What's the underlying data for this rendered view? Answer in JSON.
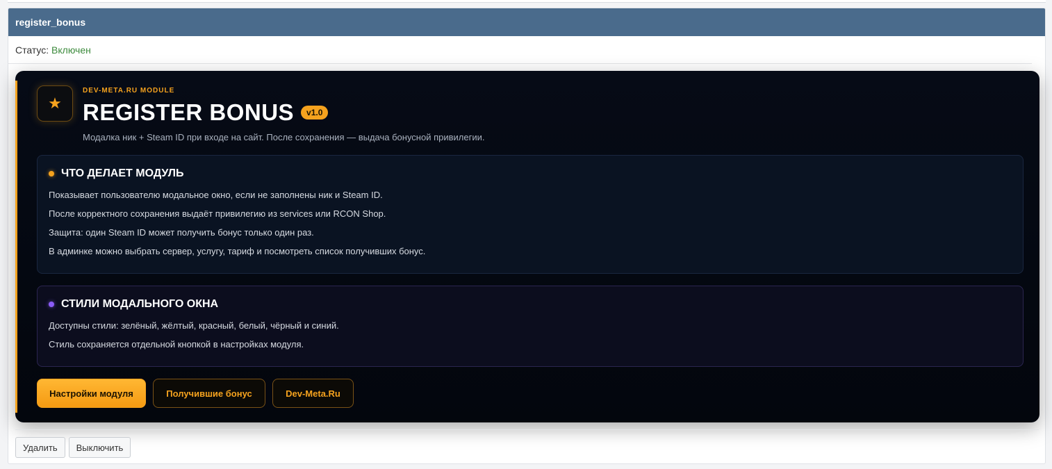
{
  "panel": {
    "title": "register_bonus",
    "status_label": "Статус:",
    "status_value": "Включен"
  },
  "module": {
    "kicker": "DEV-META.RU MODULE",
    "title": "REGISTER BONUS",
    "version": "v1.0",
    "subtitle": "Модалка ник + Steam ID при входе на сайт. После сохранения — выдача бонусной привилегии.",
    "icon": "star-icon"
  },
  "sections": [
    {
      "title": "ЧТО ДЕЛАЕТ МОДУЛЬ",
      "lines": [
        "Показывает пользователю модальное окно, если не заполнены ник и Steam ID.",
        "После корректного сохранения выдаёт привилегию из services или RCON Shop.",
        "Защита: один Steam ID может получить бонус только один раз.",
        "В админке можно выбрать сервер, услугу, тариф и посмотреть список получивших бонус."
      ]
    },
    {
      "title": "СТИЛИ МОДАЛЬНОГО ОКНА",
      "lines": [
        "Доступны стили: зелёный, жёлтый, красный, белый, чёрный и синий.",
        "Стиль сохраняется отдельной кнопкой в настройках модуля."
      ]
    }
  ],
  "buttons": {
    "settings": "Настройки модуля",
    "bonus_list": "Получившие бонус",
    "site": "Dev-Meta.Ru"
  },
  "footer": {
    "delete": "Удалить",
    "disable": "Выключить"
  },
  "colors": {
    "header_bg": "#4a6b8c",
    "accent": "#f5a21e",
    "status_on": "#3c8a3c",
    "purple": "#8b5cf6"
  }
}
